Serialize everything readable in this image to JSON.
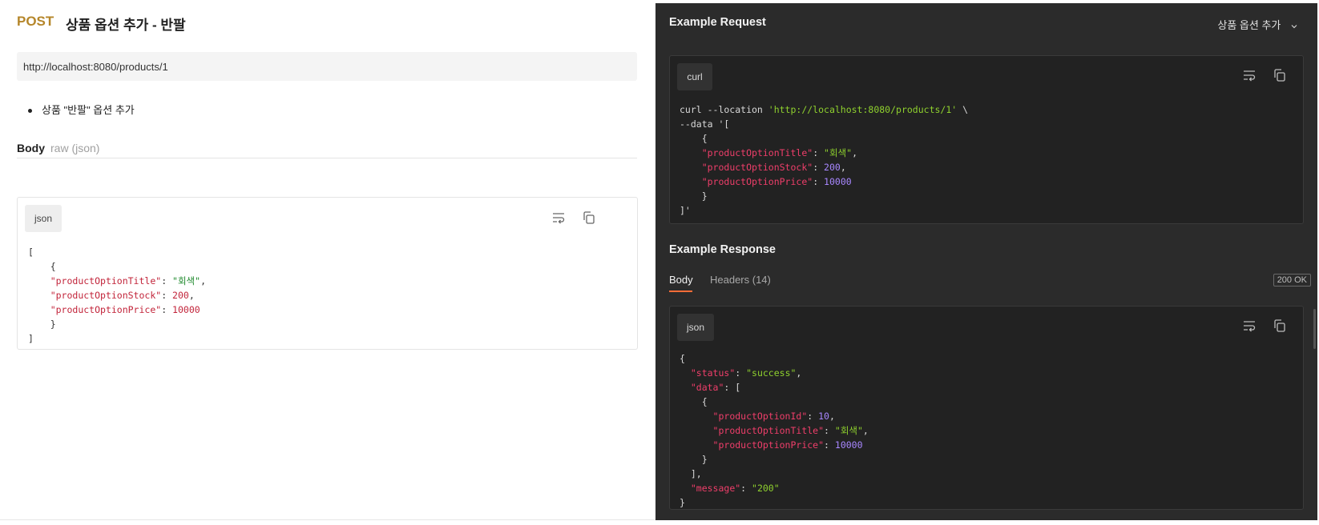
{
  "request": {
    "method": "POST",
    "title": "상품 옵션 추가 - 반팔",
    "url": "http://localhost:8080/products/1",
    "description_bullet": "상품 \"반팔\" 옵션 추가",
    "body_label": "Body",
    "body_type": "raw (json)",
    "code_lang": "json"
  },
  "example_request": {
    "title": "Example Request",
    "dropdown_label": "상품 옵션 추가",
    "code_lang": "curl"
  },
  "example_response": {
    "title": "Example Response",
    "tabs": [
      {
        "label": "Body"
      },
      {
        "label": "Headers (14)"
      }
    ],
    "status": "200 OK",
    "code_lang": "json"
  },
  "colors": {
    "method": "#b5862a",
    "panel_dark": "#2b2b2b",
    "tab_accent": "#ff6c37"
  },
  "icons": [
    "wrap-lines-icon",
    "copy-icon",
    "chevron-down-icon"
  ]
}
